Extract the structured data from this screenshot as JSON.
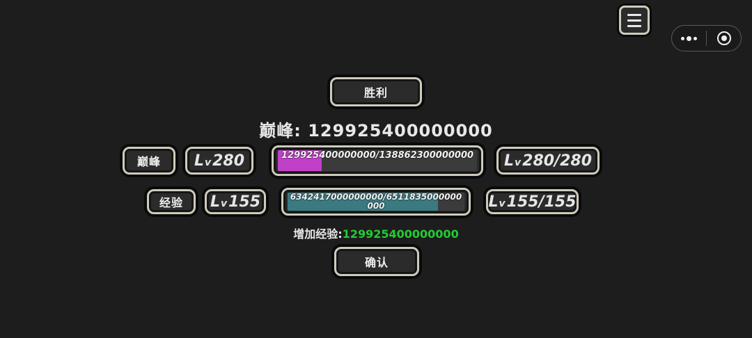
{
  "capsule": {
    "more_icon": "more-dots-icon",
    "close_icon": "target-circle-icon"
  },
  "victory": {
    "label": "胜利"
  },
  "peak": {
    "label": "巅峰:",
    "value": "129925400000000"
  },
  "peak_row": {
    "tag": "巅峰",
    "level_prefix_L": "L",
    "level_prefix_v": "v",
    "level": "280",
    "progress_text": "129925400000000/138862300000000",
    "progress_fraction": 0.22,
    "progress_color": "#c040c8",
    "max_level": "280/280"
  },
  "exp_row": {
    "tag": "经验",
    "level_prefix_L": "L",
    "level_prefix_v": "v",
    "level": "155",
    "progress_text": "6342417000000000/6511835000000000",
    "progress_fraction": 0.85,
    "progress_color": "#3a7a80",
    "max_level": "155/155"
  },
  "gain": {
    "label": "增加经验:",
    "value": "129925400000000",
    "value_color": "#22cc33"
  },
  "confirm": {
    "label": "确认"
  }
}
